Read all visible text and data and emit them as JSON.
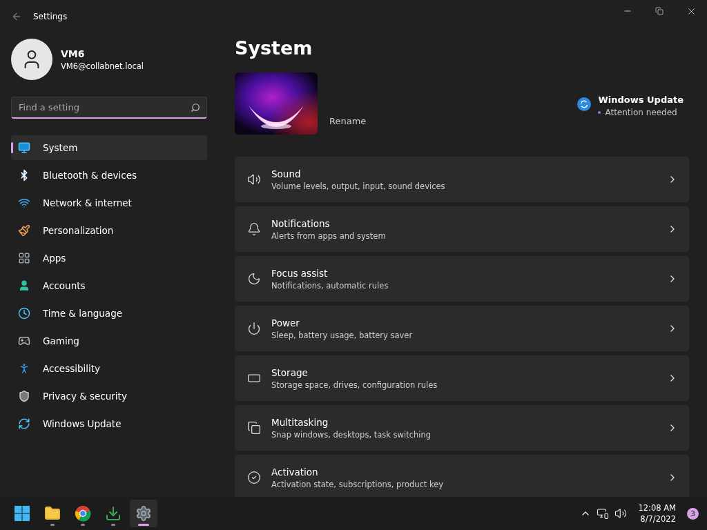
{
  "window": {
    "title": "Settings"
  },
  "profile": {
    "name": "VM6",
    "email": "VM6@collabnet.local"
  },
  "search": {
    "placeholder": "Find a setting"
  },
  "nav": [
    {
      "label": "System",
      "kind": "system",
      "selected": true
    },
    {
      "label": "Bluetooth & devices",
      "kind": "bluetooth",
      "selected": false
    },
    {
      "label": "Network & internet",
      "kind": "network",
      "selected": false
    },
    {
      "label": "Personalization",
      "kind": "brush",
      "selected": false
    },
    {
      "label": "Apps",
      "kind": "apps",
      "selected": false
    },
    {
      "label": "Accounts",
      "kind": "accounts",
      "selected": false
    },
    {
      "label": "Time & language",
      "kind": "time",
      "selected": false
    },
    {
      "label": "Gaming",
      "kind": "gaming",
      "selected": false
    },
    {
      "label": "Accessibility",
      "kind": "accessibility",
      "selected": false
    },
    {
      "label": "Privacy & security",
      "kind": "privacy",
      "selected": false
    },
    {
      "label": "Windows Update",
      "kind": "update",
      "selected": false
    }
  ],
  "page": {
    "title": "System",
    "device": {
      "kind": "picture",
      "action": "Rename"
    },
    "update": {
      "title": "Windows Update",
      "status": "Attention needed"
    }
  },
  "cards": [
    {
      "kind": "sound",
      "title": "Sound",
      "subtitle": "Volume levels, output, input, sound devices"
    },
    {
      "kind": "notifications",
      "title": "Notifications",
      "subtitle": "Alerts from apps and system"
    },
    {
      "kind": "focus",
      "title": "Focus assist",
      "subtitle": "Notifications, automatic rules"
    },
    {
      "kind": "power",
      "title": "Power",
      "subtitle": "Sleep, battery usage, battery saver"
    },
    {
      "kind": "storage",
      "title": "Storage",
      "subtitle": "Storage space, drives, configuration rules"
    },
    {
      "kind": "multitasking",
      "title": "Multitasking",
      "subtitle": "Snap windows, desktops, task switching"
    },
    {
      "kind": "activation",
      "title": "Activation",
      "subtitle": "Activation state, subscriptions, product key"
    }
  ],
  "taskbar": {
    "apps": [
      {
        "kind": "start",
        "running": false,
        "selected": false
      },
      {
        "kind": "explorer",
        "running": true,
        "selected": false
      },
      {
        "kind": "browser",
        "running": true,
        "selected": false
      },
      {
        "kind": "download",
        "running": true,
        "selected": false
      },
      {
        "kind": "settings",
        "running": true,
        "selected": true
      }
    ],
    "time": "12:08 AM",
    "date": "8/7/2022",
    "notifications": "3"
  }
}
